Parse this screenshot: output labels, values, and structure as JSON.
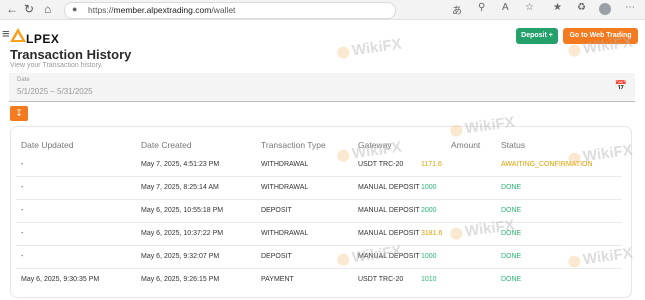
{
  "browser": {
    "url_prefix": "https://",
    "url_host": "member.alpextrading.com",
    "url_path": "/wallet"
  },
  "app": {
    "logo_text": "LPEX",
    "deposit_label": "Deposit +",
    "web_trading_label": "Go to Web Trading"
  },
  "page": {
    "title": "Transaction History",
    "subtitle": "View your Transaction history.",
    "date_label": "Date",
    "date_range": "5/1/2025 – 5/31/2025"
  },
  "table": {
    "headers": [
      "Date Updated",
      "Date Created",
      "Transaction Type",
      "Gateway",
      "Amount",
      "Status"
    ],
    "rows": [
      {
        "updated": "-",
        "created": "May 7, 2025, 4:51:23 PM",
        "type": "WITHDRAWAL",
        "gateway": "USDT TRC-20",
        "amount": "1171.6",
        "status": "AWAITING_CONFIRMATION",
        "amount_color": "orange",
        "status_color": "orange"
      },
      {
        "updated": "-",
        "created": "May 7, 2025, 8:25:14 AM",
        "type": "WITHDRAWAL",
        "gateway": "MANUAL DEPOSIT",
        "amount": "1000",
        "status": "DONE",
        "amount_color": "green",
        "status_color": "green"
      },
      {
        "updated": "-",
        "created": "May 6, 2025, 10:55:18 PM",
        "type": "DEPOSIT",
        "gateway": "MANUAL DEPOSIT",
        "amount": "2000",
        "status": "DONE",
        "amount_color": "green",
        "status_color": "green"
      },
      {
        "updated": "-",
        "created": "May 6, 2025, 10:37:22 PM",
        "type": "WITHDRAWAL",
        "gateway": "MANUAL DEPOSIT",
        "amount": "3181.6",
        "status": "DONE",
        "amount_color": "orange",
        "status_color": "green"
      },
      {
        "updated": "-",
        "created": "May 6, 2025, 9:32:07 PM",
        "type": "DEPOSIT",
        "gateway": "MANUAL DEPOSIT",
        "amount": "1000",
        "status": "DONE",
        "amount_color": "green",
        "status_color": "green"
      },
      {
        "updated": "May 6, 2025, 9:30:35 PM",
        "created": "May 6, 2025, 9:26:15 PM",
        "type": "PAYMENT",
        "gateway": "USDT TRC-20",
        "amount": "1010",
        "status": "DONE",
        "amount_color": "green",
        "status_color": "green"
      }
    ]
  },
  "watermark": "WikiFX",
  "colors": {
    "accent_orange": "#f47a1f",
    "deposit_green": "#24a06b",
    "status_green": "#2bb673",
    "status_orange": "#e0a000"
  }
}
